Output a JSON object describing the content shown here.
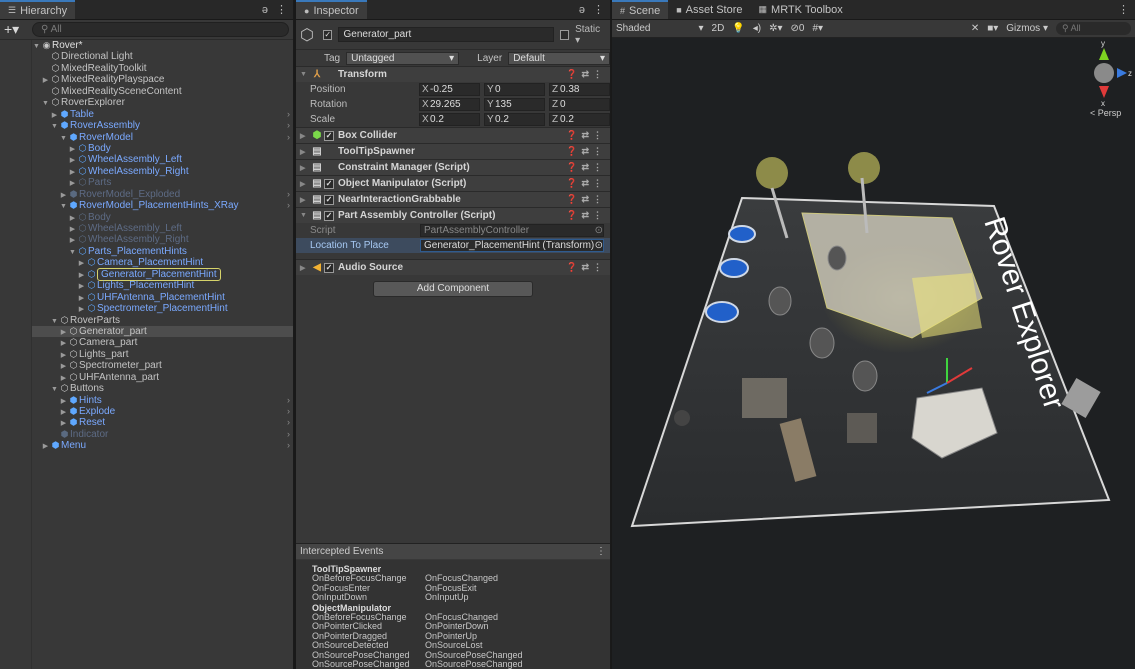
{
  "hierarchy": {
    "tab": "Hierarchy",
    "search_placeholder": "All",
    "rows": [
      {
        "label": "Rover*",
        "indent": 0,
        "arrow": "▼",
        "icon": "◉",
        "cls": "root"
      },
      {
        "label": "Directional Light",
        "indent": 1,
        "arrow": "",
        "icon": "⬡",
        "cls": ""
      },
      {
        "label": "MixedRealityToolkit",
        "indent": 1,
        "arrow": "",
        "icon": "⬡",
        "cls": ""
      },
      {
        "label": "MixedRealityPlayspace",
        "indent": 1,
        "arrow": "▶",
        "icon": "⬡",
        "cls": ""
      },
      {
        "label": "MixedRealitySceneContent",
        "indent": 1,
        "arrow": "",
        "icon": "⬡",
        "cls": ""
      },
      {
        "label": "RoverExplorer",
        "indent": 1,
        "arrow": "▼",
        "icon": "⬡",
        "cls": ""
      },
      {
        "label": "Table",
        "indent": 2,
        "arrow": "▶",
        "icon": "⬢",
        "cls": "blue",
        "chev": true
      },
      {
        "label": "RoverAssembly",
        "indent": 2,
        "arrow": "▼",
        "icon": "⬢",
        "cls": "blue",
        "chev": true
      },
      {
        "label": "RoverModel",
        "indent": 3,
        "arrow": "▼",
        "icon": "⬢",
        "cls": "blue",
        "chev": true
      },
      {
        "label": "Body",
        "indent": 4,
        "arrow": "▶",
        "icon": "⬡",
        "cls": "blue"
      },
      {
        "label": "WheelAssembly_Left",
        "indent": 4,
        "arrow": "▶",
        "icon": "⬡",
        "cls": "blue"
      },
      {
        "label": "WheelAssembly_Right",
        "indent": 4,
        "arrow": "▶",
        "icon": "⬡",
        "cls": "blue"
      },
      {
        "label": "Parts",
        "indent": 4,
        "arrow": "▶",
        "icon": "⬡",
        "cls": "faded"
      },
      {
        "label": "RoverModel_Exploded",
        "indent": 3,
        "arrow": "▶",
        "icon": "⬢",
        "cls": "faded",
        "chev": true
      },
      {
        "label": "RoverModel_PlacementHints_XRay",
        "indent": 3,
        "arrow": "▼",
        "icon": "⬢",
        "cls": "blue",
        "chev": true
      },
      {
        "label": "Body",
        "indent": 4,
        "arrow": "▶",
        "icon": "⬡",
        "cls": "faded"
      },
      {
        "label": "WheelAssembly_Left",
        "indent": 4,
        "arrow": "▶",
        "icon": "⬡",
        "cls": "faded"
      },
      {
        "label": "WheelAssembly_Right",
        "indent": 4,
        "arrow": "▶",
        "icon": "⬡",
        "cls": "faded"
      },
      {
        "label": "Parts_PlacementHints",
        "indent": 4,
        "arrow": "▼",
        "icon": "⬡",
        "cls": "blue"
      },
      {
        "label": "Camera_PlacementHint",
        "indent": 5,
        "arrow": "▶",
        "icon": "⬡",
        "cls": "blue"
      },
      {
        "label": "Generator_PlacementHint",
        "indent": 5,
        "arrow": "▶",
        "icon": "⬡",
        "cls": "blue boxed"
      },
      {
        "label": "Lights_PlacementHint",
        "indent": 5,
        "arrow": "▶",
        "icon": "⬡",
        "cls": "blue"
      },
      {
        "label": "UHFAntenna_PlacementHint",
        "indent": 5,
        "arrow": "▶",
        "icon": "⬡",
        "cls": "blue"
      },
      {
        "label": "Spectrometer_PlacementHint",
        "indent": 5,
        "arrow": "▶",
        "icon": "⬡",
        "cls": "blue"
      },
      {
        "label": "RoverParts",
        "indent": 2,
        "arrow": "▼",
        "icon": "⬡",
        "cls": ""
      },
      {
        "label": "Generator_part",
        "indent": 3,
        "arrow": "▶",
        "icon": "⬡",
        "cls": "sel"
      },
      {
        "label": "Camera_part",
        "indent": 3,
        "arrow": "▶",
        "icon": "⬡",
        "cls": ""
      },
      {
        "label": "Lights_part",
        "indent": 3,
        "arrow": "▶",
        "icon": "⬡",
        "cls": ""
      },
      {
        "label": "Spectrometer_part",
        "indent": 3,
        "arrow": "▶",
        "icon": "⬡",
        "cls": ""
      },
      {
        "label": "UHFAntenna_part",
        "indent": 3,
        "arrow": "▶",
        "icon": "⬡",
        "cls": ""
      },
      {
        "label": "Buttons",
        "indent": 2,
        "arrow": "▼",
        "icon": "⬡",
        "cls": ""
      },
      {
        "label": "Hints",
        "indent": 3,
        "arrow": "▶",
        "icon": "⬢",
        "cls": "blue",
        "chev": true
      },
      {
        "label": "Explode",
        "indent": 3,
        "arrow": "▶",
        "icon": "⬢",
        "cls": "blue",
        "chev": true
      },
      {
        "label": "Reset",
        "indent": 3,
        "arrow": "▶",
        "icon": "⬢",
        "cls": "blue",
        "chev": true
      },
      {
        "label": "Indicator",
        "indent": 2,
        "arrow": "",
        "icon": "⬢",
        "cls": "faded",
        "chev": true
      },
      {
        "label": "Menu",
        "indent": 1,
        "arrow": "▶",
        "icon": "⬢",
        "cls": "blue",
        "chev": true
      }
    ]
  },
  "inspector": {
    "tab": "Inspector",
    "object_name": "Generator_part",
    "static_label": "Static",
    "tag_label": "Tag",
    "tag_value": "Untagged",
    "layer_label": "Layer",
    "layer_value": "Default",
    "transform": {
      "title": "Transform",
      "position_label": "Position",
      "position": [
        "-0.25",
        "0",
        "0.38"
      ],
      "rotation_label": "Rotation",
      "rotation": [
        "29.265",
        "135",
        "0"
      ],
      "scale_label": "Scale",
      "scale": [
        "0.2",
        "0.2",
        "0.2"
      ]
    },
    "components": [
      {
        "name": "Box Collider",
        "check": true,
        "icon": "⬢",
        "icon_color": "#7bd84a"
      },
      {
        "name": "ToolTipSpawner",
        "check": false,
        "icon": "▤",
        "icon_color": "#d0d0d0"
      },
      {
        "name": "Constraint Manager (Script)",
        "check": false,
        "icon": "▤",
        "icon_color": "#d0d0d0"
      },
      {
        "name": "Object Manipulator (Script)",
        "check": true,
        "icon": "▤",
        "icon_color": "#d0d0d0"
      },
      {
        "name": "NearInteractionGrabbable",
        "check": true,
        "icon": "▤",
        "icon_color": "#d0d0d0"
      },
      {
        "name": "Part Assembly Controller (Script)",
        "check": true,
        "icon": "▤",
        "icon_color": "#d0d0d0",
        "expanded": true
      }
    ],
    "script_label": "Script",
    "script_value": "PartAssemblyController",
    "location_label": "Location To Place",
    "location_value": "Generator_PlacementHint (Transform)",
    "audio_source": "Audio Source",
    "add_component": "Add Component",
    "events_title": "Intercepted Events",
    "event_groups": [
      {
        "name": "ToolTipSpawner",
        "rows": [
          [
            "OnBeforeFocusChange",
            "OnFocusChanged"
          ],
          [
            "OnFocusEnter",
            "OnFocusExit"
          ],
          [
            "OnInputDown",
            "OnInputUp"
          ]
        ]
      },
      {
        "name": "ObjectManipulator",
        "rows": [
          [
            "OnBeforeFocusChange",
            "OnFocusChanged"
          ],
          [
            "OnPointerClicked",
            "OnPointerDown"
          ],
          [
            "OnPointerDragged",
            "OnPointerUp"
          ],
          [
            "OnSourceDetected",
            "OnSourceLost"
          ],
          [
            "OnSourcePoseChanged",
            "OnSourcePoseChanged"
          ],
          [
            "OnSourcePoseChanged",
            "OnSourcePoseChanged"
          ]
        ]
      }
    ]
  },
  "scene": {
    "tabs": [
      "Scene",
      "Asset Store",
      "MRTK Toolbox"
    ],
    "shading": "Shaded",
    "mode_2d": "2D",
    "hidden_count": "0",
    "gizmos": "Gizmos",
    "search_placeholder": "All",
    "persp_label": "< Persp",
    "table_text": "Rover Explorer",
    "axis_y": "y",
    "axis_z": "z",
    "axis_x": "x"
  }
}
